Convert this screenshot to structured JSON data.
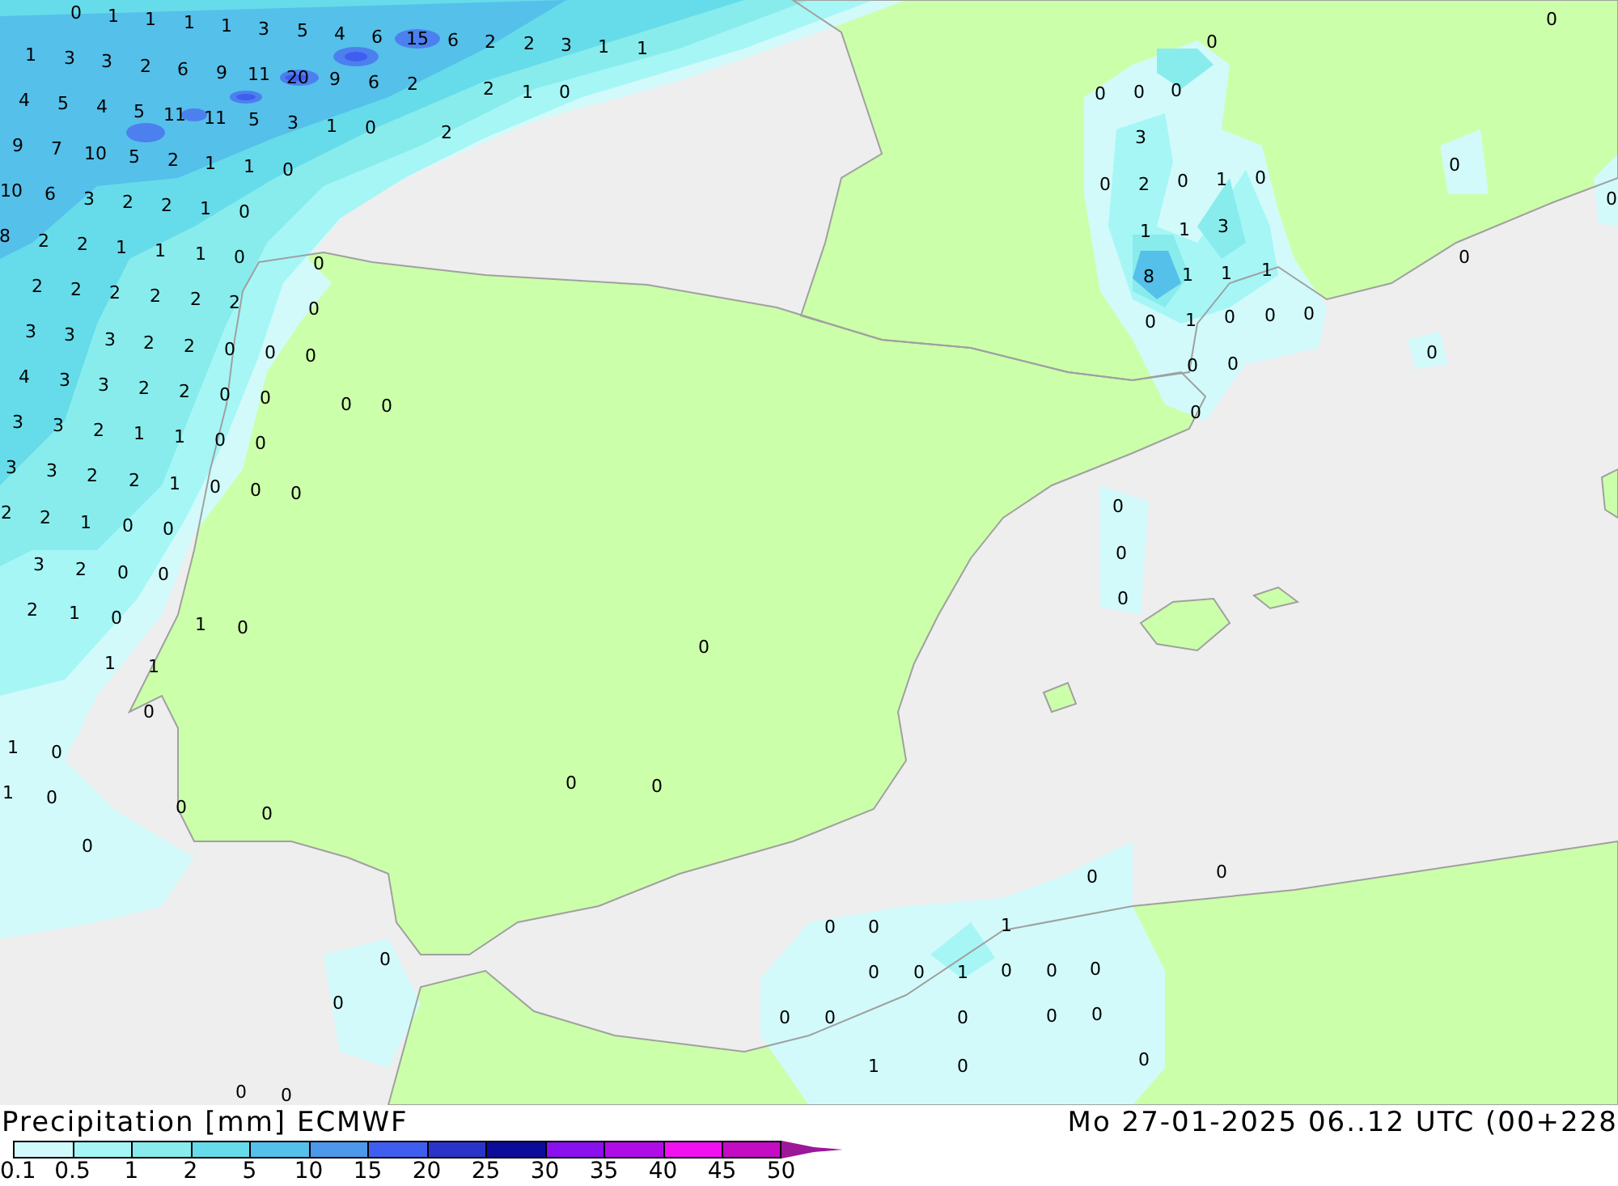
{
  "map_labels": [
    "0",
    "1",
    "1",
    "1",
    "1",
    "3",
    "5",
    "4",
    "6",
    "15",
    "6",
    "2",
    "2",
    "3",
    "1",
    "1",
    "1",
    "3",
    "3",
    "2",
    "6",
    "9",
    "11",
    "20",
    "9",
    "6",
    "2",
    "2",
    "1",
    "0",
    "4",
    "5",
    "4",
    "5",
    "11",
    "11",
    "5",
    "3",
    "1",
    "0",
    "2",
    "9",
    "7",
    "10",
    "5",
    "2",
    "1",
    "1",
    "0",
    "10",
    "6",
    "3",
    "2",
    "2",
    "1",
    "0",
    "8",
    "2",
    "2",
    "1",
    "1",
    "1",
    "0",
    "0",
    "2",
    "2",
    "2",
    "2",
    "2",
    "2",
    "0",
    "3",
    "3",
    "3",
    "2",
    "2",
    "0",
    "0",
    "0",
    "4",
    "3",
    "3",
    "2",
    "2",
    "0",
    "0",
    "0",
    "0",
    "3",
    "3",
    "2",
    "1",
    "1",
    "0",
    "0",
    "3",
    "3",
    "2",
    "2",
    "1",
    "0",
    "0",
    "0",
    "2",
    "2",
    "1",
    "0",
    "0",
    "3",
    "2",
    "0",
    "0",
    "2",
    "1",
    "0",
    "1",
    "0",
    "1",
    "1",
    "0",
    "1",
    "0",
    "1",
    "0",
    "0",
    "0",
    "0",
    "0",
    "0",
    "0",
    "0",
    "0",
    "0",
    "0",
    "0",
    "0",
    "0",
    "0",
    "0",
    "3",
    "0",
    "2",
    "0",
    "1",
    "0",
    "0",
    "0",
    "1",
    "1",
    "3",
    "8",
    "1",
    "1",
    "1",
    "0",
    "0",
    "1",
    "0",
    "0",
    "0",
    "0",
    "0",
    "0",
    "0",
    "0",
    "0",
    "0",
    "0",
    "0",
    "0",
    "1",
    "0",
    "0",
    "1",
    "0",
    "0",
    "0",
    "0",
    "0",
    "0",
    "0",
    "0",
    "1",
    "0",
    "0",
    "0"
  ],
  "legend": {
    "title": "Precipitation [mm] ECMWF",
    "valid_time": "Mo 27-01-2025 06..12 UTC (00+228",
    "scale": [
      {
        "label": "0.1",
        "color": "#d2fafa"
      },
      {
        "label": "0.5",
        "color": "#a6f6f6"
      },
      {
        "label": "1",
        "color": "#88ecec"
      },
      {
        "label": "2",
        "color": "#66dcea"
      },
      {
        "label": "5",
        "color": "#55c0ea"
      },
      {
        "label": "10",
        "color": "#4c98ea"
      },
      {
        "label": "15",
        "color": "#3f5ef0"
      },
      {
        "label": "20",
        "color": "#2a34c8"
      },
      {
        "label": "25",
        "color": "#0c0c9a"
      },
      {
        "label": "30",
        "color": "#8a10ee"
      },
      {
        "label": "35",
        "color": "#b00ce8"
      },
      {
        "label": "40",
        "color": "#f010f0"
      },
      {
        "label": "45",
        "color": "#c40cc4"
      },
      {
        "label": "50",
        "color": "#9c1898"
      }
    ]
  }
}
